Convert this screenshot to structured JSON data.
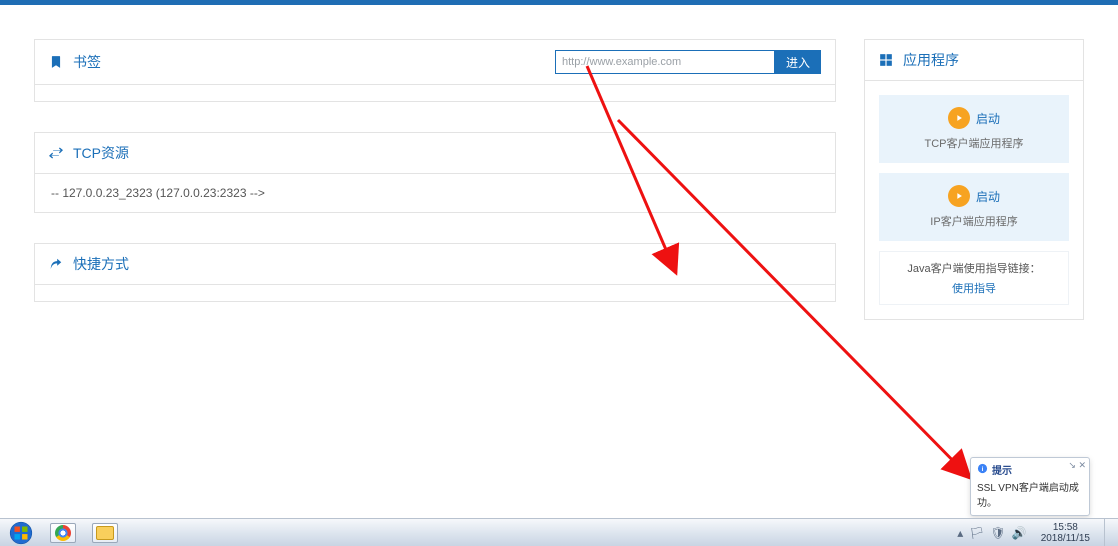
{
  "bookmarks": {
    "title": "书签",
    "url_input_value": "http://www.example.com",
    "go_label": "进入"
  },
  "tcp": {
    "title": "TCP资源",
    "items": [
      {
        "text": "-- 127.0.0.23_2323 (127.0.0.23:2323 -->"
      }
    ]
  },
  "shortcut": {
    "title": "快捷方式"
  },
  "apps": {
    "title": "应用程序",
    "cards": [
      {
        "launch_label": "启动",
        "subtitle": "TCP客户端应用程序"
      },
      {
        "launch_label": "启动",
        "subtitle": "IP客户端应用程序"
      }
    ],
    "guide": {
      "text": "Java客户端使用指导链接：",
      "link_label": "使用指导"
    }
  },
  "balloon": {
    "title": "提示",
    "message": "SSL VPN客户端启动成功。"
  },
  "taskbar": {
    "time": "15:58",
    "date": "2018/11/15"
  }
}
